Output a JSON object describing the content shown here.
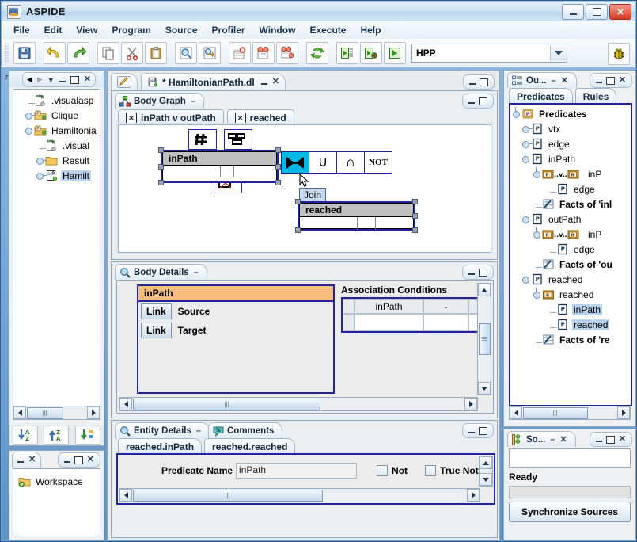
{
  "window": {
    "title": "ASPIDE",
    "app_icon": "java-coffee-icon",
    "buttons": {
      "minimize": "–",
      "maximize": "□",
      "close": "✕"
    }
  },
  "menu": {
    "items": [
      "File",
      "Edit",
      "View",
      "Program",
      "Source",
      "Profiler",
      "Window",
      "Execute",
      "Help"
    ]
  },
  "toolbar": {
    "buttons": [
      "save-icon",
      "undo-icon",
      "redo-icon",
      "copy-icon",
      "cut-icon",
      "paste-icon",
      "find-icon",
      "find-replace-icon",
      "run-one-icon",
      "run-group-icon",
      "run-all-icon",
      "refresh-icon",
      "run-config-icon",
      "run-debug-icon",
      "run-play-icon"
    ],
    "combo_value": "HPP",
    "debug_button": "bug-icon"
  },
  "project_panel": {
    "nav": {
      "back": "◀",
      "forward": "▶",
      "menu": "▼",
      "minimize": "–",
      "maximize": "□",
      "close": "✕"
    },
    "tree": [
      {
        "label": ".visualasp",
        "icon": "xml-file-icon",
        "indent": 1,
        "toggle": "none",
        "selected": false
      },
      {
        "label": "Clique",
        "icon": "project-folder-icon",
        "indent": 1,
        "toggle": "closed",
        "selected": false
      },
      {
        "label": "Hamiltonia",
        "icon": "project-folder-icon",
        "indent": 1,
        "toggle": "open",
        "selected": false
      },
      {
        "label": ".visual",
        "icon": "xml-file-icon",
        "indent": 2,
        "toggle": "none",
        "selected": false
      },
      {
        "label": "Result",
        "icon": "folder-icon",
        "indent": 2,
        "toggle": "closed",
        "selected": false
      },
      {
        "label": "Hamilt",
        "icon": "dlv-file-icon",
        "indent": 2,
        "toggle": "closed",
        "selected": true
      }
    ],
    "sort_buttons": [
      "sort-az-descending-icon",
      "sort-za-ascending-icon",
      "sort-custom-icon"
    ]
  },
  "workspace_panel": {
    "nav": {
      "minimize": "–",
      "close": "✕"
    },
    "frame_buttons": {
      "minimize": "–",
      "maximize": "□",
      "close": "✕"
    },
    "items": [
      {
        "label": "Workspace",
        "icon": "workspace-folder-icon"
      }
    ]
  },
  "editor": {
    "pencil_tab_icon": "edit-pencil-icon",
    "document_tab": {
      "label": "* HamiltonianPath.dl",
      "icon": "dlv-file-icon",
      "minimize": "–",
      "close": "✕"
    },
    "frame_buttons": {
      "minimize": "–",
      "maximize": "□"
    }
  },
  "body_graph": {
    "title": "Body Graph",
    "title_icon": "graph-nodes-icon",
    "minimize_glyph": "–",
    "frame_buttons": {
      "minimize": "–",
      "maximize": "□"
    },
    "tabs": [
      {
        "label": "inPath v outPath",
        "icon": "close-box-icon",
        "active": false
      },
      {
        "label": "reached",
        "icon": "close-box-icon",
        "active": true
      }
    ],
    "nodes": [
      {
        "label": "inPath",
        "selected": true
      },
      {
        "label": "reached",
        "selected": true
      }
    ],
    "small_tools": [
      "grid-icon",
      "align-icon",
      "delete-box-icon"
    ],
    "palette": [
      {
        "icon": "join-bowtie-icon",
        "name": "Join",
        "selected": true
      },
      {
        "icon": "union-icon",
        "name": "Union",
        "selected": false
      },
      {
        "icon": "intersection-icon",
        "name": "Intersection",
        "selected": false
      },
      {
        "icon": "not-icon",
        "name": "NOT",
        "label": "NOT",
        "selected": false
      }
    ],
    "tooltip": "Join",
    "cursor": "arrow-pointer"
  },
  "body_details": {
    "title": "Body Details",
    "title_icon": "magnifier-icon",
    "minimize_glyph": "–",
    "frame_buttons": {
      "minimize": "–",
      "maximize": "□"
    },
    "card": {
      "header": "inPath",
      "header_color": "#f7bd7c",
      "rows": [
        {
          "button": "Link",
          "label": "Source"
        },
        {
          "button": "Link",
          "label": "Target"
        }
      ]
    },
    "association": {
      "title": "Association Conditions",
      "columns": [
        "",
        "inPath",
        "-",
        ""
      ],
      "rows": [
        [
          "",
          "",
          "",
          ""
        ]
      ]
    }
  },
  "entity_details": {
    "title": "Entity Details",
    "title_icon": "magnifier-icon",
    "minimize_glyph": "–",
    "comments_tab": "Comments",
    "comments_icon": "comment-bubble-icon",
    "frame_buttons": {
      "minimize": "–",
      "maximize": "□"
    },
    "tabs": [
      {
        "label": "reached.inPath",
        "active": true
      },
      {
        "label": "reached.reached",
        "active": false
      }
    ],
    "form": {
      "predicate_label": "Predicate Name",
      "predicate_value": "inPath",
      "checkbox_not": "Not",
      "checkbox_true_not": "True Not",
      "not_checked": false,
      "true_not_checked": false
    }
  },
  "outline": {
    "title": "Ou...",
    "title_icon": "outline-icon",
    "minimize_glyph": "–",
    "close_glyph": "✕",
    "frame_buttons": {
      "minimize": "–",
      "maximize": "□",
      "close": "✕"
    },
    "tabs": [
      {
        "label": "Predicates",
        "active": true
      },
      {
        "label": "Rules",
        "active": false
      }
    ],
    "tree": [
      {
        "label": "Predicates",
        "icon": "predicates-root-icon",
        "indent": 0,
        "toggle": "open",
        "selected": false
      },
      {
        "label": "vtx",
        "icon": "predicate-icon",
        "indent": 1,
        "toggle": "closed",
        "selected": false
      },
      {
        "label": "edge",
        "icon": "predicate-icon",
        "indent": 1,
        "toggle": "closed",
        "selected": false
      },
      {
        "label": "inPath",
        "icon": "predicate-icon",
        "indent": 1,
        "toggle": "open",
        "selected": false
      },
      {
        "label": "inP",
        "icon": "rule-pair-icon",
        "indent": 2,
        "toggle": "open",
        "selected": false
      },
      {
        "label": "edge",
        "icon": "predicate-icon",
        "indent": 3,
        "toggle": "none",
        "selected": false
      },
      {
        "label": "Facts of 'inl",
        "icon": "facts-icon",
        "indent": 2,
        "toggle": "none",
        "selected": false
      },
      {
        "label": "outPath",
        "icon": "predicate-icon",
        "indent": 1,
        "toggle": "open",
        "selected": false
      },
      {
        "label": "inP",
        "icon": "rule-pair-icon",
        "indent": 2,
        "toggle": "open",
        "selected": false
      },
      {
        "label": "edge",
        "icon": "predicate-icon",
        "indent": 3,
        "toggle": "none",
        "selected": false
      },
      {
        "label": "Facts of 'ou",
        "icon": "facts-icon",
        "indent": 2,
        "toggle": "none",
        "selected": false
      },
      {
        "label": "reached",
        "icon": "predicate-icon",
        "indent": 1,
        "toggle": "open",
        "selected": false
      },
      {
        "label": "reached",
        "icon": "rule-icon",
        "indent": 2,
        "toggle": "open",
        "selected": false
      },
      {
        "label": "inPath",
        "icon": "predicate-icon",
        "indent": 3,
        "toggle": "none",
        "selected": true
      },
      {
        "label": "reached",
        "icon": "predicate-icon",
        "indent": 3,
        "toggle": "none",
        "selected": true
      },
      {
        "label": "Facts of 're",
        "icon": "facts-icon",
        "indent": 2,
        "toggle": "none",
        "selected": false
      }
    ]
  },
  "sources_panel": {
    "title": "So...",
    "title_icon": "sources-icon",
    "minimize_glyph": "–",
    "close_glyph": "✕",
    "frame_buttons": {
      "minimize": "–",
      "maximize": "□",
      "close": "✕"
    },
    "field_value": "",
    "status": "Ready",
    "progress": 0,
    "button": "Synchronize Sources"
  },
  "colors": {
    "accent": "#23239c",
    "selection": "#b9d3ec",
    "card_header": "#f7bd7c",
    "palette_active": "#00b8e6",
    "node_header": "#c0c0c0",
    "desktop": "#6fa4d6"
  }
}
